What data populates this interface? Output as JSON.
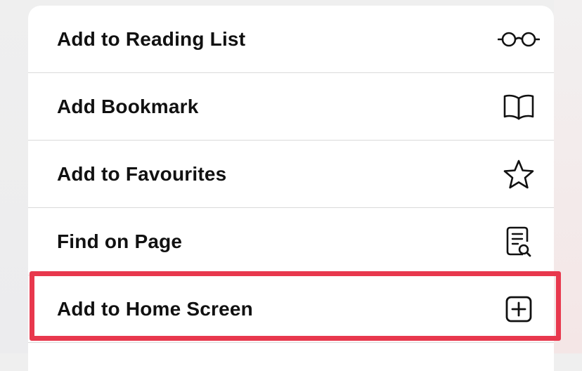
{
  "menu": {
    "items": [
      {
        "label": "Add to Reading List",
        "icon": "glasses-icon"
      },
      {
        "label": "Add Bookmark",
        "icon": "book-icon"
      },
      {
        "label": "Add to Favourites",
        "icon": "star-icon"
      },
      {
        "label": "Find on Page",
        "icon": "find-on-page-icon"
      },
      {
        "label": "Add to Home Screen",
        "icon": "add-square-icon"
      }
    ]
  },
  "colors": {
    "highlight": "#e8384d",
    "text": "#111111",
    "divider": "#dadada"
  }
}
